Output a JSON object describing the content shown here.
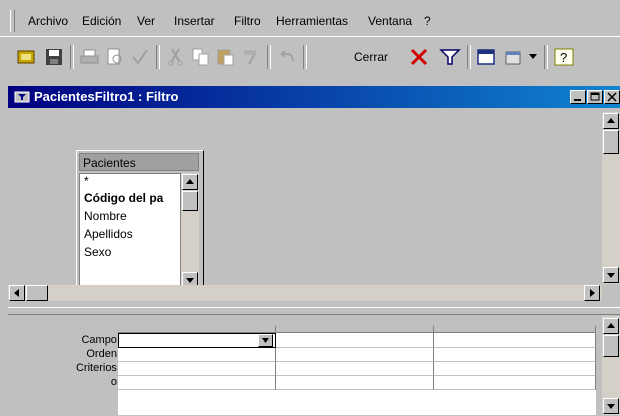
{
  "menu": {
    "items": [
      "Archivo",
      "Edición",
      "Ver",
      "Insertar",
      "Filtro",
      "Herramientas",
      "Ventana",
      "?"
    ]
  },
  "toolbar": {
    "icons": [
      "filter-object-icon",
      "save-icon",
      "print-icon",
      "print-preview-icon",
      "spelling-icon",
      "cut-icon",
      "copy-icon",
      "paste-icon",
      "format-painter-icon",
      "undo-icon"
    ],
    "close_label": "Cerrar",
    "right_icons": [
      "clear-grid-icon",
      "apply-filter-icon",
      "database-window-icon",
      "new-object-icon",
      "help-icon"
    ]
  },
  "window": {
    "title": "PacientesFiltro1 : Filtro"
  },
  "field_list": {
    "title": "Pacientes",
    "fields": [
      "*",
      "Código del pa",
      "Nombre",
      "Apellidos",
      "Sexo"
    ]
  },
  "grid": {
    "row_labels": [
      "Campo:",
      "Orden:",
      "Criterios:",
      "o:"
    ]
  },
  "colors": {
    "title_bar_start": "#000080",
    "title_bar_end": "#1084d0",
    "face": "#c0c0c0"
  }
}
